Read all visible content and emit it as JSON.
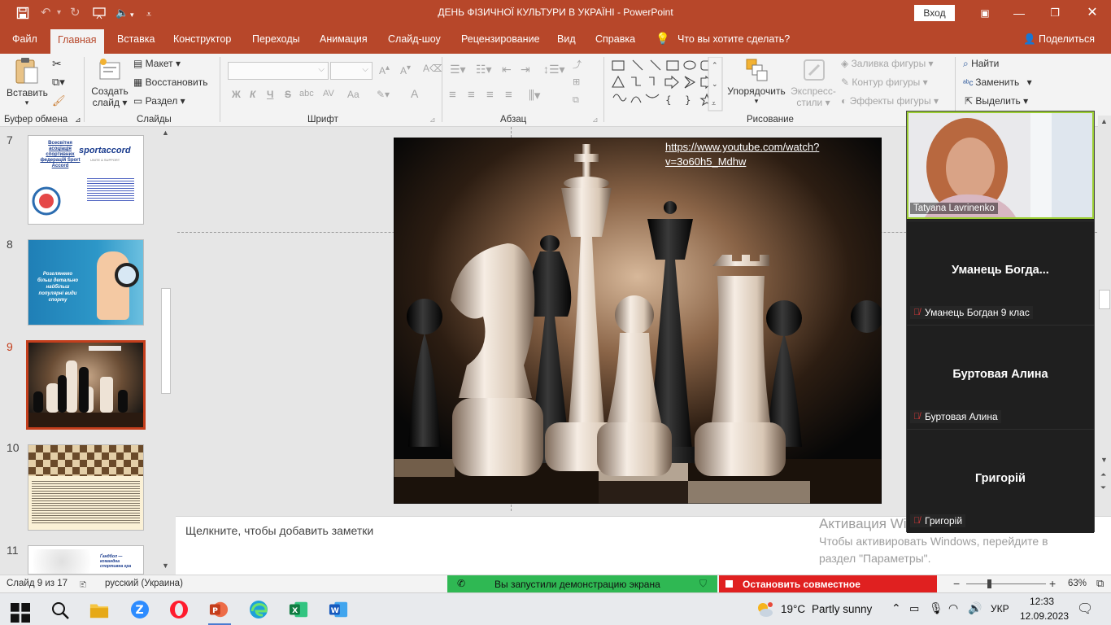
{
  "window": {
    "title": "ДЕНЬ ФІЗИЧНОЇ КУЛЬТУРИ В УКРАЇНІ  -  PowerPoint",
    "signin_label": "Вход"
  },
  "tabs": [
    "Файл",
    "Главная",
    "Вставка",
    "Конструктор",
    "Переходы",
    "Анимация",
    "Слайд-шоу",
    "Рецензирование",
    "Вид",
    "Справка"
  ],
  "active_tab": "Главная",
  "tell_me": "Что вы хотите сделать?",
  "share_label": "Поделиться",
  "ribbon": {
    "clipboard": {
      "label": "Буфер обмена",
      "paste": "Вставить"
    },
    "slides": {
      "label": "Слайды",
      "new_slide": "Создать",
      "new_slide2": "слайд",
      "layout": "Макет",
      "reset": "Восстановить",
      "section": "Раздел"
    },
    "font": {
      "label": "Шрифт",
      "bold": "Ж",
      "italic": "К",
      "underline": "Ч",
      "strike": "S",
      "shadow": "abc",
      "spacing": "AV",
      "case": "Aa",
      "color": "A"
    },
    "paragraph": {
      "label": "Абзац"
    },
    "drawing": {
      "label": "Рисование",
      "arrange": "Упорядочить",
      "quick_styles": "Экспресс-",
      "quick_styles2": "стили",
      "fill": "Заливка фигуры",
      "outline": "Контур фигуры",
      "effects": "Эффекты фигуры"
    },
    "editing": {
      "find": "Найти",
      "replace": "Заменить",
      "select": "Выделить"
    }
  },
  "thumbnails": [
    {
      "number": "7",
      "title": "Всесвітня асоціація спортивних федерацій Sport Accord",
      "logo": "sportaccord",
      "tagline": "UNITE & SUPPORT"
    },
    {
      "number": "8",
      "caption": "Розглянемо більш детально найбільш популярні види спорту"
    },
    {
      "number": "9"
    },
    {
      "number": "10"
    },
    {
      "number": "11",
      "caption": "Ґандбол — командна спортивна гра"
    }
  ],
  "slide": {
    "link_text": "https://www.youtube.com/watch?v=3o60h5_Mdhw"
  },
  "notes_placeholder": "Щелкните, чтобы добавить заметки",
  "activation": {
    "title": "Активация Windows",
    "line1": "Чтобы активировать Windows, перейдите в",
    "line2": "раздел \"Параметры\"."
  },
  "zoom": {
    "participants": [
      {
        "video_label": "Tatyana Lavrinenko"
      },
      {
        "name": "Уманець  Богда...",
        "label": "Уманець Богдан 9 клас"
      },
      {
        "name": "Буртовая Алина",
        "label": "Буртовая Алина"
      },
      {
        "name": "Григорій",
        "label": "Григорій"
      }
    ]
  },
  "status": {
    "slide_of": "Слайд 9 из 17",
    "language": "русский (Украина)",
    "sharing": "Вы запустили демонстрацию экрана",
    "stop_share": "Остановить совместное использование",
    "zoom_level": "63%"
  },
  "taskbar": {
    "weather_temp": "19°C",
    "weather_desc": "Partly sunny",
    "lang": "УКР",
    "time": "12:33",
    "date": "12.09.2023"
  },
  "colors": {
    "accent": "#b7472a",
    "selected": "#c43e1c",
    "share_green": "#2fb853",
    "share_red": "#e02020"
  }
}
